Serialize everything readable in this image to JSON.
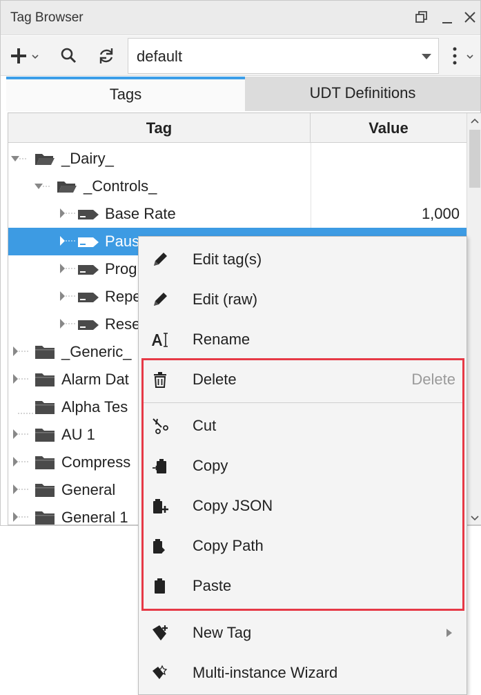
{
  "window": {
    "title": "Tag Browser"
  },
  "toolbar": {
    "provider": "default"
  },
  "tabs": [
    {
      "label": "Tags"
    },
    {
      "label": "UDT Definitions"
    }
  ],
  "columns": {
    "tag": "Tag",
    "value": "Value"
  },
  "tree": {
    "rows": [
      {
        "label": "_Dairy_",
        "value": ""
      },
      {
        "label": "_Controls_",
        "value": ""
      },
      {
        "label": "Base Rate",
        "value": "1,000"
      },
      {
        "label": "Paus",
        "value": ""
      },
      {
        "label": "Prog",
        "value": ""
      },
      {
        "label": "Repe",
        "value": ""
      },
      {
        "label": "Rese",
        "value": ""
      },
      {
        "label": "_Generic_",
        "value": ""
      },
      {
        "label": "Alarm Dat",
        "value": ""
      },
      {
        "label": "Alpha Tes",
        "value": ""
      },
      {
        "label": "AU 1",
        "value": ""
      },
      {
        "label": "Compress",
        "value": ""
      },
      {
        "label": "General",
        "value": ""
      },
      {
        "label": "General 1",
        "value": ""
      }
    ]
  },
  "menu": {
    "items": [
      {
        "label": "Edit tag(s)",
        "icon": "pencil-icon"
      },
      {
        "label": "Edit (raw)",
        "icon": "pencil-icon"
      },
      {
        "label": "Rename",
        "icon": "rename-icon"
      },
      {
        "label": "Delete",
        "icon": "trash-icon",
        "shortcut": "Delete"
      },
      {
        "label": "Cut",
        "icon": "scissors-icon"
      },
      {
        "label": "Copy",
        "icon": "copy-icon"
      },
      {
        "label": "Copy JSON",
        "icon": "copy-json-icon"
      },
      {
        "label": "Copy Path",
        "icon": "copy-path-icon"
      },
      {
        "label": "Paste",
        "icon": "paste-icon"
      },
      {
        "label": "New Tag",
        "icon": "new-tag-icon"
      },
      {
        "label": "Multi-instance Wizard",
        "icon": "wizard-icon"
      }
    ]
  },
  "colors": {
    "selection": "#3d9be3",
    "tab_accent": "#3c9ee8",
    "highlight_box": "#e63946"
  }
}
